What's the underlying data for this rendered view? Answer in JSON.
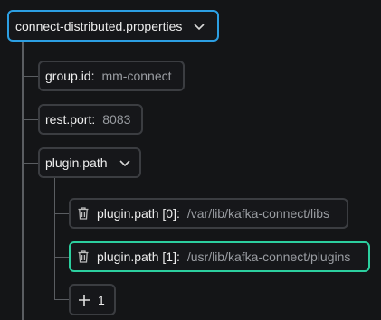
{
  "root": {
    "label": "connect-distributed.properties"
  },
  "items": [
    {
      "key": "group.id",
      "value": "mm-connect"
    },
    {
      "key": "rest.port",
      "value": "8083"
    }
  ],
  "plugin_path": {
    "key": "plugin.path",
    "entries": [
      {
        "key": "plugin.path [0]",
        "value": "/var/lib/kafka-connect/libs"
      },
      {
        "key": "plugin.path [1]",
        "value": "/usr/lib/kafka-connect/plugins"
      }
    ],
    "add_label": "1"
  },
  "colors": {
    "root_border": "#2c9fe3",
    "selected_border": "#2ccf9f"
  },
  "icons": {
    "expand": "chevron-down-icon",
    "delete": "trash-icon",
    "add": "plus-icon"
  }
}
